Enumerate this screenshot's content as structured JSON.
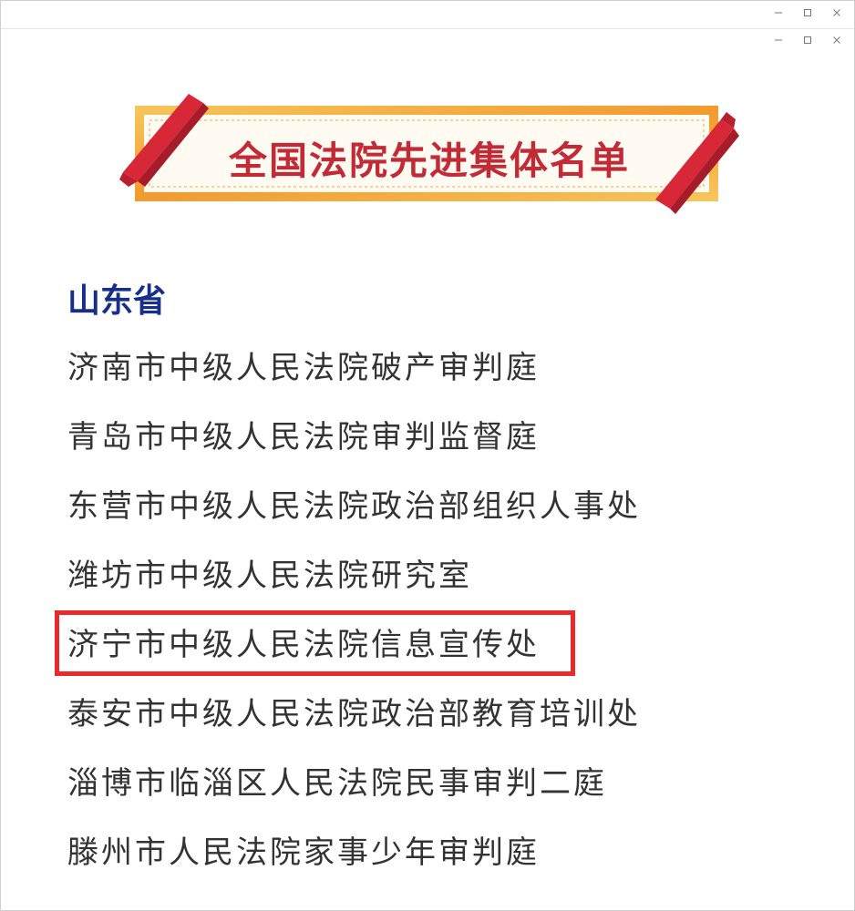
{
  "banner": {
    "title": "全国法院先进集体名单"
  },
  "province": "山东省",
  "items": [
    "济南市中级人民法院破产审判庭",
    "青岛市中级人民法院审判监督庭",
    "东营市中级人民法院政治部组织人事处",
    "潍坊市中级人民法院研究室",
    "济宁市中级人民法院信息宣传处",
    "泰安市中级人民法院政治部教育培训处",
    "淄博市临淄区人民法院民事审判二庭",
    "滕州市人民法院家事少年审判庭"
  ],
  "highlighted_item": "济宁市中级人民法院信息宣传处",
  "colors": {
    "banner_title": "#c22a35",
    "ribbon": "#d82838",
    "banner_border": "#f0a53a",
    "province": "#172e8a",
    "highlight_box": "#ea2a2a"
  },
  "icons": {
    "window_controls": [
      "minimize-icon",
      "maximize-icon",
      "close-icon"
    ]
  }
}
